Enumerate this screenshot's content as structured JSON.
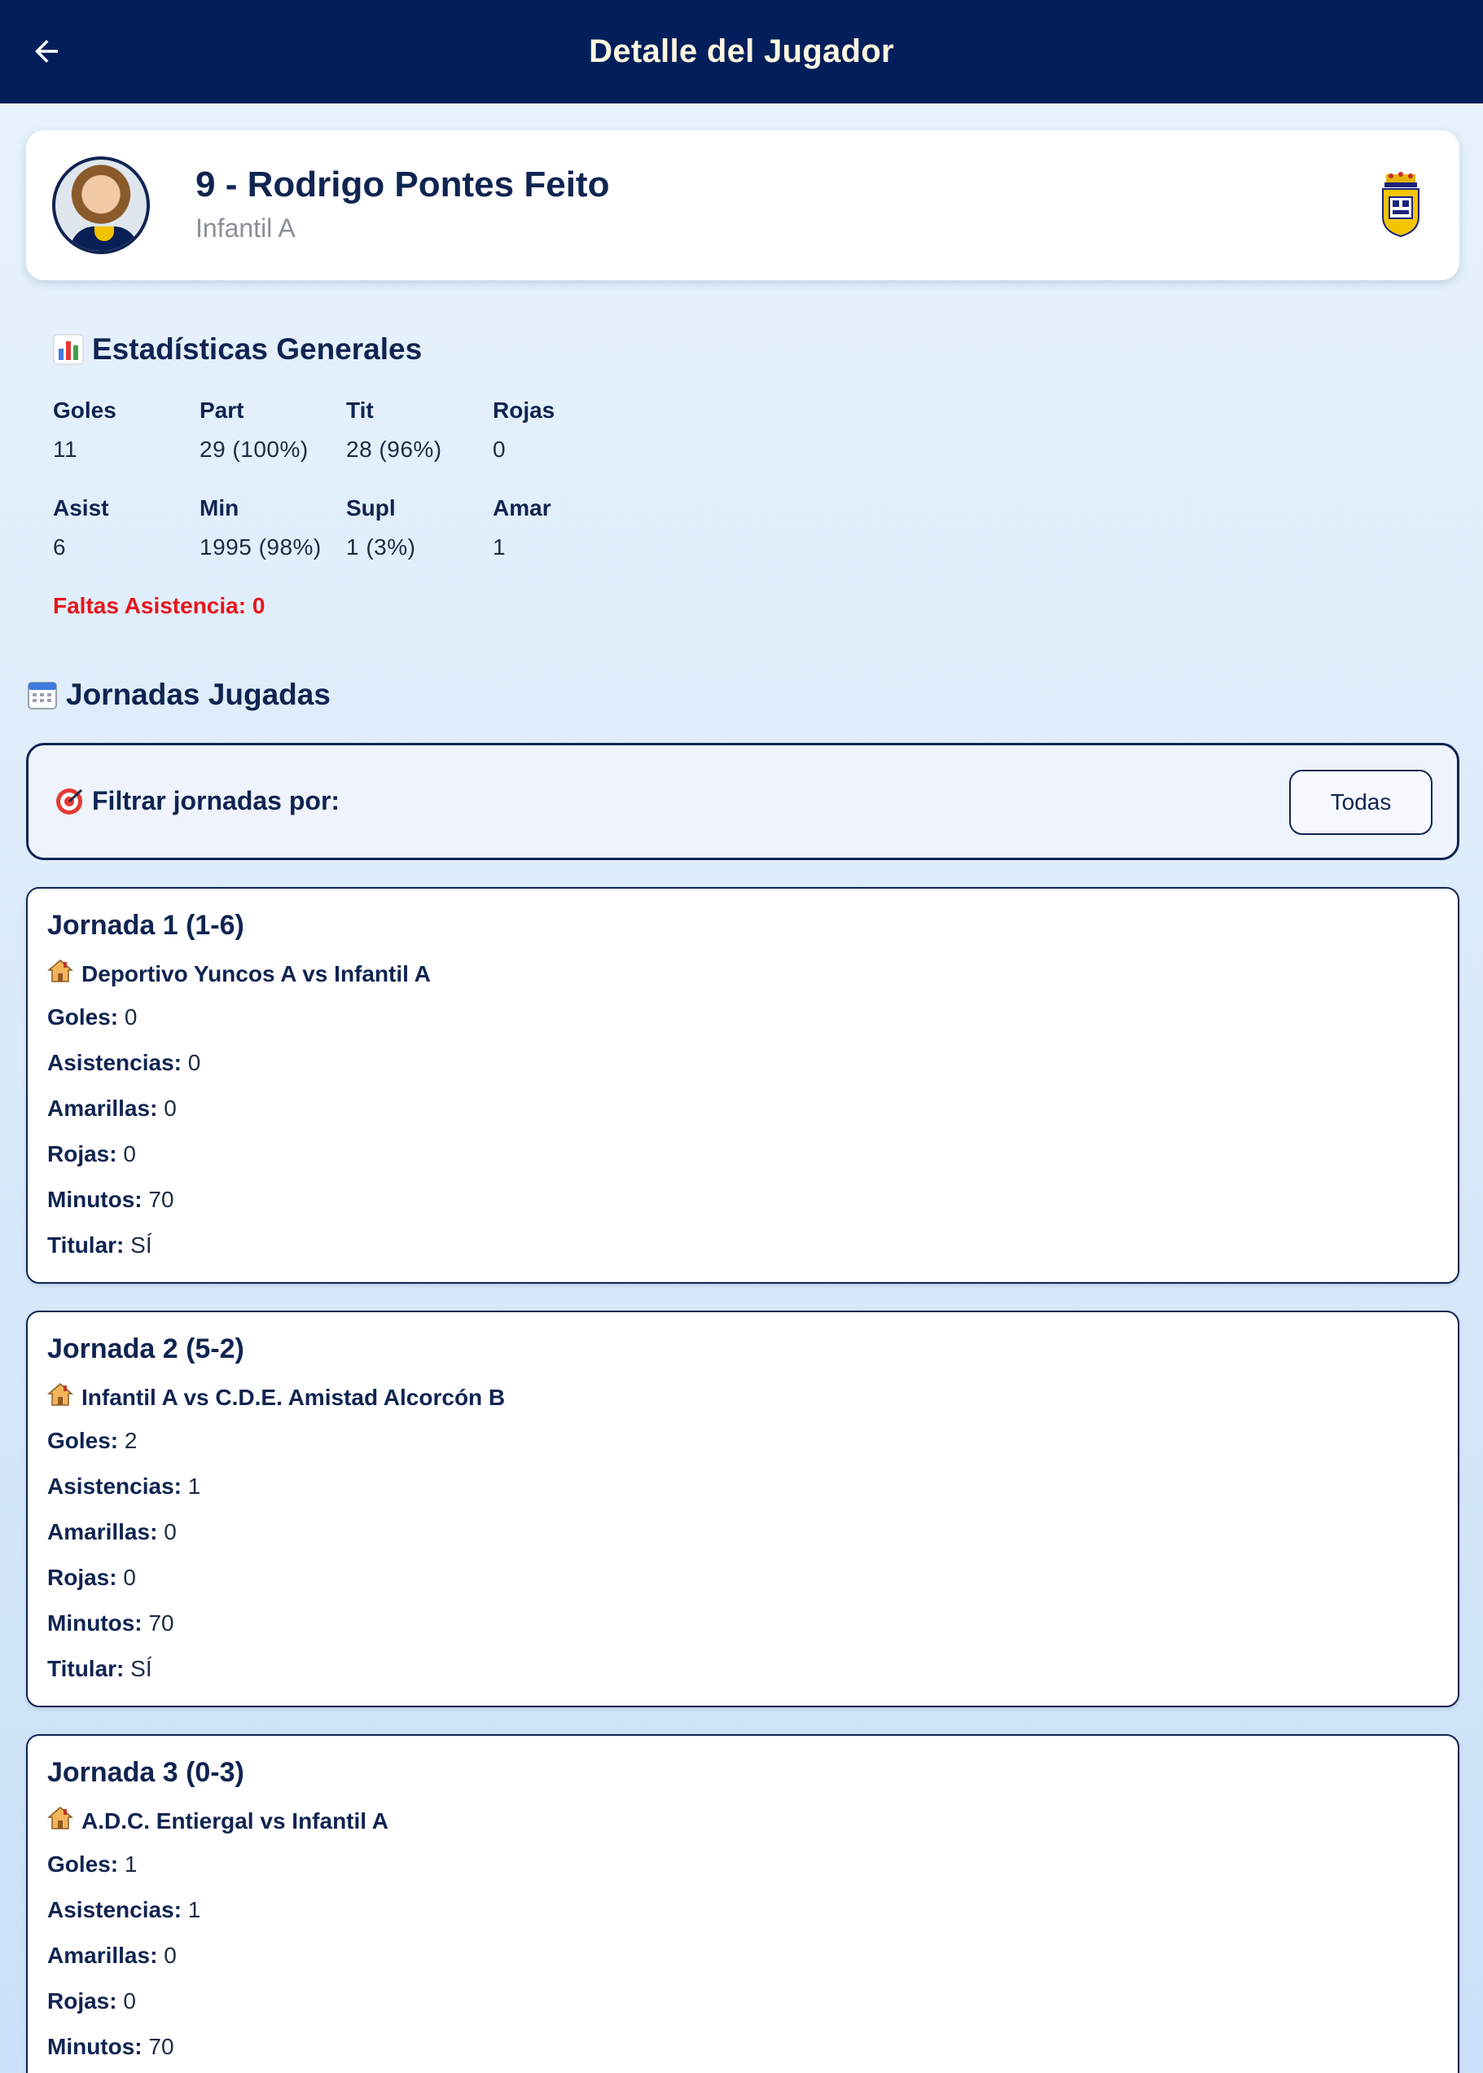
{
  "header": {
    "title": "Detalle del Jugador",
    "back_icon": "arrow-left-icon"
  },
  "player": {
    "name": "9 - Rodrigo Pontes Feito",
    "team": "Infantil A",
    "avatar_icon": "player-photo",
    "crest_icon": "club-crest-icon"
  },
  "stats": {
    "title": "Estadísticas Generales",
    "icon": "bar-chart-icon",
    "row1": [
      {
        "label": "Goles",
        "value": "11"
      },
      {
        "label": "Part",
        "value": "29 (100%)"
      },
      {
        "label": "Tit",
        "value": "28 (96%)"
      },
      {
        "label": "Rojas",
        "value": "0"
      }
    ],
    "row2": [
      {
        "label": "Asist",
        "value": "6"
      },
      {
        "label": "Min",
        "value": "1995 (98%)"
      },
      {
        "label": "Supl",
        "value": "1 (3%)"
      },
      {
        "label": "Amar",
        "value": "1"
      }
    ],
    "faltas": "Faltas Asistencia: 0"
  },
  "jornadas": {
    "title": "Jornadas Jugadas",
    "icon": "calendar-icon",
    "filter": {
      "label": "Filtrar jornadas por:",
      "icon": "target-icon",
      "button": "Todas"
    },
    "labels": {
      "goles": "Goles:",
      "asistencias": "Asistencias:",
      "amarillas": "Amarillas:",
      "rojas": "Rojas:",
      "minutos": "Minutos:",
      "titular": "Titular:"
    },
    "matches": [
      {
        "title": "Jornada 1 (1-6)",
        "fixture": "Deportivo Yuncos A vs Infantil A",
        "home_icon": "house-icon",
        "goles": "0",
        "asistencias": "0",
        "amarillas": "0",
        "rojas": "0",
        "minutos": "70",
        "titular": "SÍ"
      },
      {
        "title": "Jornada 2 (5-2)",
        "fixture": "Infantil A vs C.D.E. Amistad Alcorcón B",
        "home_icon": "house-icon",
        "goles": "2",
        "asistencias": "1",
        "amarillas": "0",
        "rojas": "0",
        "minutos": "70",
        "titular": "SÍ"
      },
      {
        "title": "Jornada 3 (0-3)",
        "fixture": "A.D.C. Entiergal vs Infantil A",
        "home_icon": "house-icon",
        "goles": "1",
        "asistencias": "1",
        "amarillas": "0",
        "rojas": "0",
        "minutos": "70",
        "titular": ""
      }
    ]
  }
}
